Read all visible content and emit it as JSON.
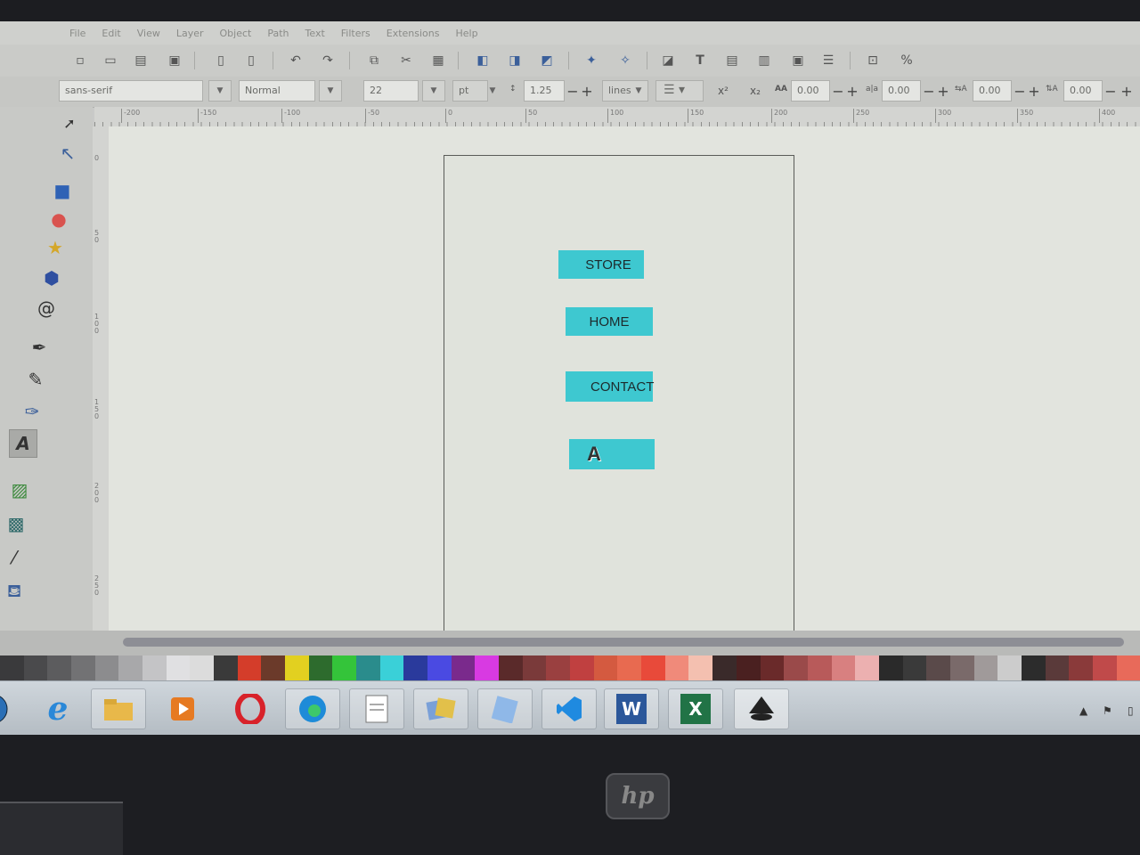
{
  "menu": {
    "items": [
      "File",
      "Edit",
      "View",
      "Layer",
      "Object",
      "Path",
      "Text",
      "Filters",
      "Extensions",
      "Help"
    ]
  },
  "text_toolbar": {
    "font_family": "sans-serif",
    "font_style": "Normal",
    "font_size": "22",
    "unit": "pt",
    "line_spacing": "1.25",
    "spacing_mode": "lines",
    "letter_spacing": "0.00",
    "word_spacing": "0.00",
    "kerning_h": "0.00",
    "kerning_v": "0.00",
    "aa_label": "AA"
  },
  "ruler": {
    "h_ticks": [
      "-200",
      "-150",
      "-100",
      "-50",
      "0",
      "50",
      "100",
      "150",
      "200",
      "250",
      "300",
      "350",
      "400"
    ],
    "v_ticks": [
      "0",
      "50",
      "100",
      "150",
      "200",
      "250"
    ]
  },
  "canvas": {
    "buttons": [
      {
        "label": "STORE"
      },
      {
        "label": "HOME"
      },
      {
        "label": "CONTACT"
      },
      {
        "label": "A"
      }
    ]
  },
  "palette": [
    "#3a3a3c",
    "#4a4a4c",
    "#5c5c5e",
    "#727274",
    "#8c8c8e",
    "#a8a8aa",
    "#c4c4c6",
    "#e0e0e2",
    "#dcdcdc",
    "#3a3a3a",
    "#d43d2a",
    "#6b3a2a",
    "#e2d020",
    "#2d6b2d",
    "#34c43a",
    "#2a8c8c",
    "#3ad0d8",
    "#2a3a9c",
    "#4a4ae2",
    "#7a2a8c",
    "#d83ae2",
    "#5a2a2a",
    "#7a3a3a",
    "#9a4040",
    "#c04040",
    "#d45a40",
    "#e86a50",
    "#e84a3a",
    "#f08a7a",
    "#f4c0b0",
    "#3a2a2a",
    "#4a2020",
    "#6a2a2a",
    "#9a4a4a",
    "#b85a5a",
    "#d88080",
    "#ecb0b0",
    "#2a2a2a",
    "#3a3a3a",
    "#5a4a4a",
    "#7a6a6a",
    "#a09a9a",
    "#cccccc",
    "#2c2c2c",
    "#5a3a3a",
    "#8a3a3a",
    "#c04a4a",
    "#e86a5a"
  ],
  "taskbar": {
    "apps": [
      "start-orb",
      "internet-explorer",
      "file-explorer",
      "media-player",
      "opera",
      "edge",
      "notepad",
      "photos",
      "document-viewer",
      "vscode",
      "word",
      "excel",
      "inkscape"
    ],
    "word_letter": "W",
    "excel_letter": "X"
  },
  "laptop": {
    "brand": "hp"
  }
}
